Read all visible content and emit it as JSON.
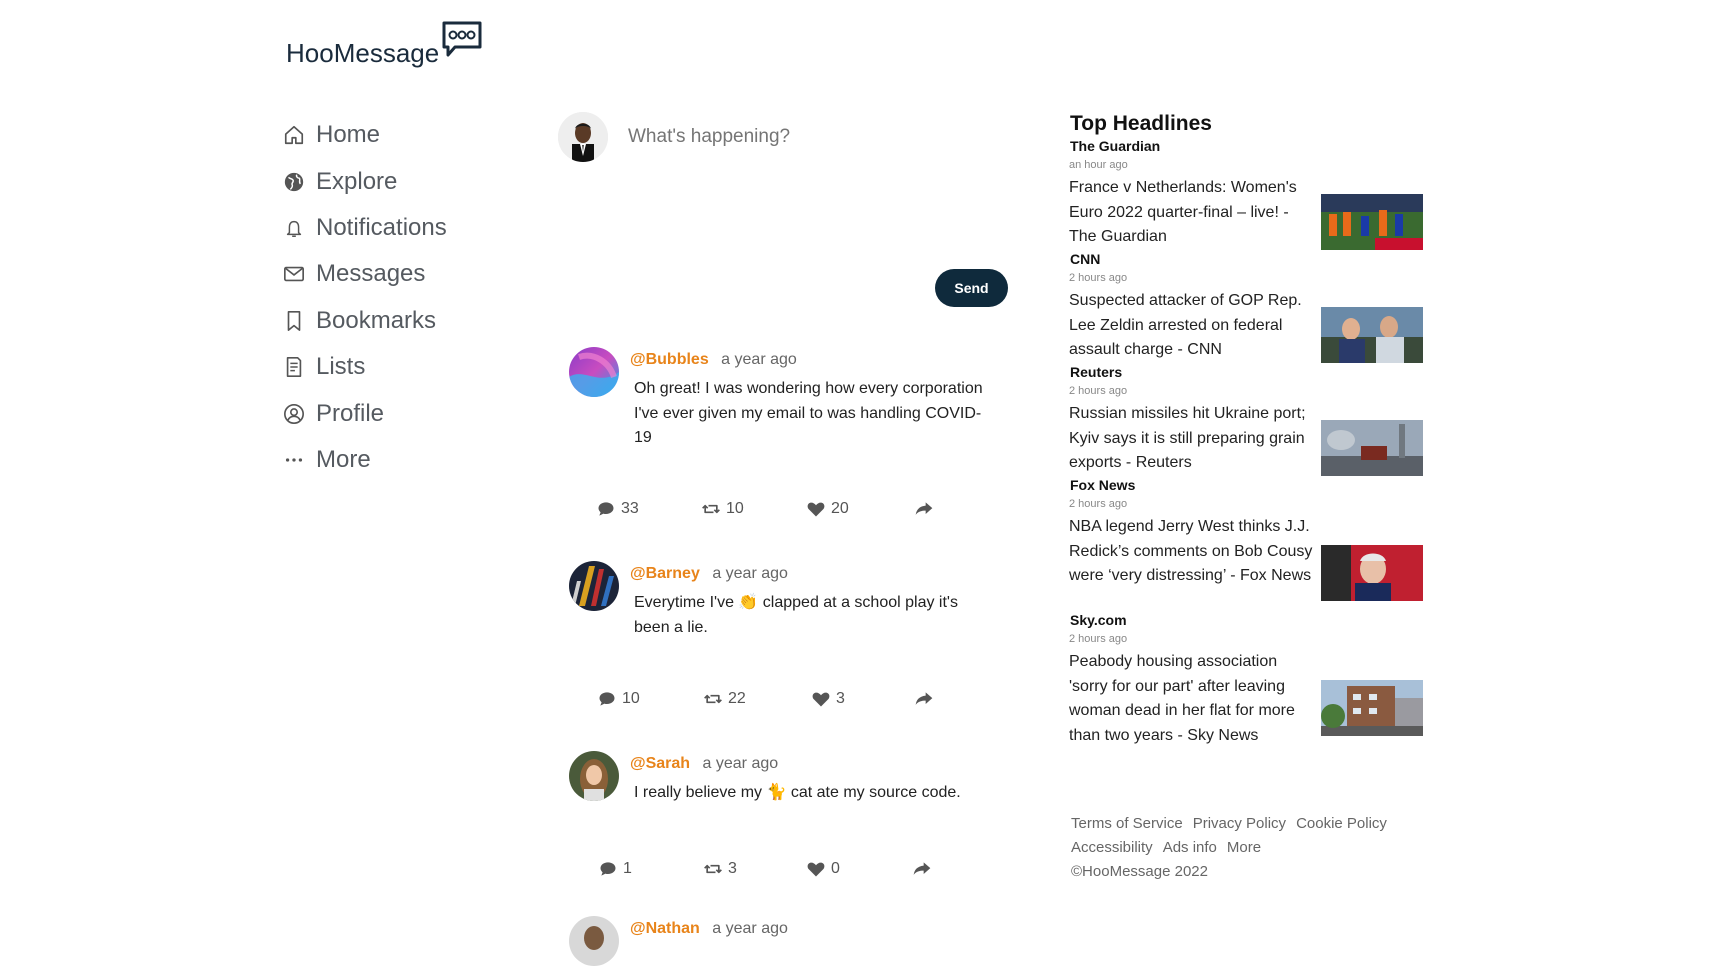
{
  "app": {
    "name": "HooMessage"
  },
  "nav": {
    "items": [
      {
        "label": "Home",
        "icon": "home-icon"
      },
      {
        "label": "Explore",
        "icon": "globe-icon"
      },
      {
        "label": "Notifications",
        "icon": "bell-icon"
      },
      {
        "label": "Messages",
        "icon": "envelope-icon"
      },
      {
        "label": "Bookmarks",
        "icon": "bookmark-icon"
      },
      {
        "label": "Lists",
        "icon": "list-icon"
      },
      {
        "label": "Profile",
        "icon": "user-circle-icon"
      },
      {
        "label": "More",
        "icon": "ellipsis-icon"
      }
    ]
  },
  "composer": {
    "placeholder": "What's happening?",
    "send_label": "Send"
  },
  "feed": {
    "posts": [
      {
        "handle": "@Bubbles",
        "time": "a year ago",
        "text": "Oh great! I was wondering how every corporation I've ever given my email to was handling COVID-19",
        "comments": "33",
        "retweets": "10",
        "likes": "20"
      },
      {
        "handle": "@Barney",
        "time": "a year ago",
        "text_before": "Everytime I've ",
        "emoji": "👏",
        "text_after": " clapped at a school play it's been a lie.",
        "comments": "10",
        "retweets": "22",
        "likes": "3"
      },
      {
        "handle": "@Sarah",
        "time": "a year ago",
        "text_before": "I really believe my ",
        "emoji": "🐈",
        "text_after": " cat ate my source code.",
        "comments": "1",
        "retweets": "3",
        "likes": "0"
      },
      {
        "handle": "@Nathan",
        "time": "a year ago"
      }
    ]
  },
  "headlines": {
    "title": "Top Headlines",
    "items": [
      {
        "source": "The Guardian",
        "ago": "an hour ago",
        "headline": "France v Netherlands: Women's Euro 2022 quarter-final – live! - The Guardian"
      },
      {
        "source": "CNN",
        "ago": "2 hours ago",
        "headline": "Suspected attacker of GOP Rep. Lee Zeldin arrested on federal assault charge - CNN"
      },
      {
        "source": "Reuters",
        "ago": "2 hours ago",
        "headline": "Russian missiles hit Ukraine port; Kyiv says it is still preparing grain exports - Reuters"
      },
      {
        "source": "Fox News",
        "ago": "2 hours ago",
        "headline": "NBA legend Jerry West thinks J.J. Redick’s comments on Bob Cousy were ‘very distressing’ - Fox News"
      },
      {
        "source": "Sky.com",
        "ago": "2 hours ago",
        "headline": "Peabody housing association 'sorry for our part' after leaving woman dead in her flat for more than two years - Sky News"
      }
    ]
  },
  "footer": {
    "links": [
      "Terms of Service",
      "Privacy Policy",
      "Cookie Policy",
      "Accessibility",
      "Ads info",
      "More"
    ],
    "copyright": "©HooMessage 2022"
  },
  "colors": {
    "accent": "#e8841a",
    "button": "#0f2a3c",
    "text_muted": "#666666"
  }
}
